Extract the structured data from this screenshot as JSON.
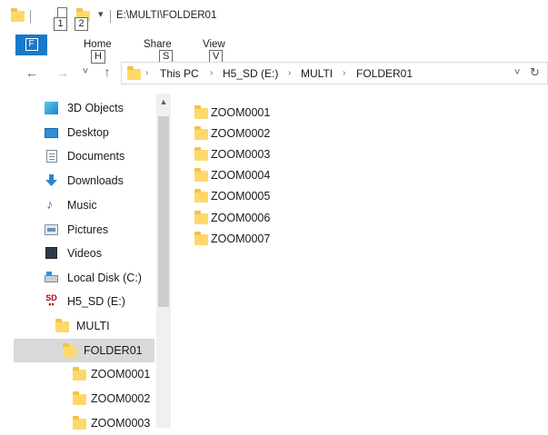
{
  "titlebar": {
    "path": "E:\\MULTI\\FOLDER01",
    "keytip_1": "1",
    "keytip_2": "2",
    "dropdown_glyph": "▾"
  },
  "ribbon": {
    "file_tab": {
      "keytip": "F"
    },
    "tabs": [
      {
        "label": "Home",
        "keytip": "H"
      },
      {
        "label": "Share",
        "keytip": "S"
      },
      {
        "label": "View",
        "keytip": "V"
      }
    ]
  },
  "nav": {
    "back": "←",
    "forward": "→",
    "recent": "˅",
    "up": "↑",
    "breadcrumb": [
      "This PC",
      "H5_SD (E:)",
      "MULTI",
      "FOLDER01"
    ],
    "separator": "›",
    "dropdown": "˅",
    "refresh": "↻"
  },
  "tree": {
    "items": [
      {
        "label": "3D Objects",
        "icon": "3d-objects-icon"
      },
      {
        "label": "Desktop",
        "icon": "desktop-icon"
      },
      {
        "label": "Documents",
        "icon": "documents-icon"
      },
      {
        "label": "Downloads",
        "icon": "downloads-icon"
      },
      {
        "label": "Music",
        "icon": "music-icon"
      },
      {
        "label": "Pictures",
        "icon": "pictures-icon"
      },
      {
        "label": "Videos",
        "icon": "videos-icon"
      },
      {
        "label": "Local Disk (C:)",
        "icon": "local-disk-icon"
      },
      {
        "label": "H5_SD (E:)",
        "icon": "sd-card-icon"
      },
      {
        "label": "MULTI",
        "icon": "folder-icon"
      },
      {
        "label": "FOLDER01",
        "icon": "folder-icon",
        "selected": true
      },
      {
        "label": "ZOOM0001",
        "icon": "folder-icon"
      },
      {
        "label": "ZOOM0002",
        "icon": "folder-icon"
      },
      {
        "label": "ZOOM0003",
        "icon": "folder-icon"
      }
    ],
    "scroll_up": "▲"
  },
  "content": {
    "items": [
      "ZOOM0001",
      "ZOOM0002",
      "ZOOM0003",
      "ZOOM0004",
      "ZOOM0005",
      "ZOOM0006",
      "ZOOM0007"
    ]
  },
  "colors": {
    "accent": "#1979ca",
    "folder": "#ffd86b",
    "selected_tree": "#d9d9d9"
  }
}
